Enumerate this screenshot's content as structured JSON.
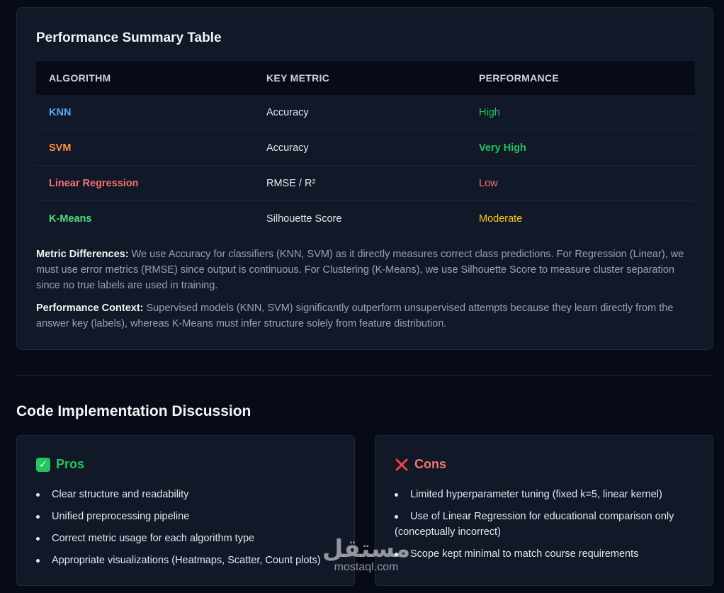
{
  "summary": {
    "title": "Performance Summary Table",
    "headers": [
      "ALGORITHM",
      "KEY METRIC",
      "PERFORMANCE"
    ],
    "rows": [
      {
        "algorithm": "KNN",
        "metric": "Accuracy",
        "performance": "High",
        "algo_color": "#60a5fa",
        "perf_color": "#22c55e"
      },
      {
        "algorithm": "SVM",
        "metric": "Accuracy",
        "performance": "Very High",
        "algo_color": "#fb923c",
        "perf_color": "#22c55e"
      },
      {
        "algorithm": "Linear Regression",
        "metric": "RMSE / R²",
        "performance": "Low",
        "algo_color": "#f87171",
        "perf_color": "#f87171"
      },
      {
        "algorithm": "K-Means",
        "metric": "Silhouette Score",
        "performance": "Moderate",
        "algo_color": "#4ade80",
        "perf_color": "#facc15"
      }
    ],
    "metric_diff_label": "Metric Differences:",
    "metric_diff_text": "We use Accuracy for classifiers (KNN, SVM) as it directly measures correct class predictions. For Regression (Linear), we must use error metrics (RMSE) since output is continuous. For Clustering (K-Means), we use Silhouette Score to measure cluster separation since no true labels are used in training.",
    "perf_context_label": "Performance Context:",
    "perf_context_text": "Supervised models (KNN, SVM) significantly outperform unsupervised attempts because they learn directly from the answer key (labels), whereas K-Means must infer structure solely from feature distribution."
  },
  "discussion": {
    "title": "Code Implementation Discussion",
    "pros": {
      "title": "Pros",
      "icon": "check-box-icon",
      "color": "#22c55e",
      "items": [
        "Clear structure and readability",
        "Unified preprocessing pipeline",
        "Correct metric usage for each algorithm type",
        "Appropriate visualizations (Heatmaps, Scatter, Count plots)"
      ]
    },
    "cons": {
      "title": "Cons",
      "icon": "cross-icon",
      "color": "#f87171",
      "items": [
        "Limited hyperparameter tuning (fixed k=5, linear kernel)",
        "Use of Linear Regression for educational comparison only (conceptually incorrect)",
        "Scope kept minimal to match course requirements"
      ]
    }
  },
  "watermark": {
    "arabic": "مستقل",
    "latin": "mostaql.com"
  }
}
